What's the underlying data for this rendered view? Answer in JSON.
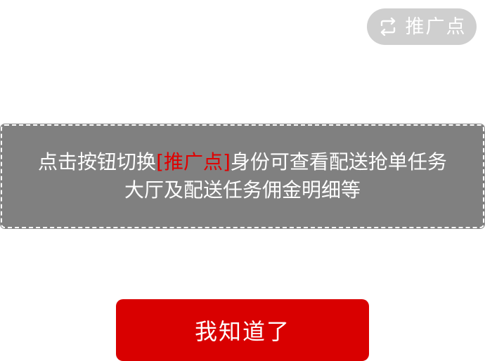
{
  "switch_button": {
    "icon": "swap-arrows-icon",
    "label": "推广点"
  },
  "guide": {
    "text_before": "点击按钮切换",
    "highlight": "[推广点]",
    "text_after": "身份可查看配送抢单任务大厅及配送任务佣金明细等"
  },
  "confirm_button": {
    "label": "我知道了"
  },
  "colors": {
    "accent": "#d90000",
    "highlight_text": "#e00000",
    "overlay": "#808080",
    "pill": "#cfcfcf"
  }
}
